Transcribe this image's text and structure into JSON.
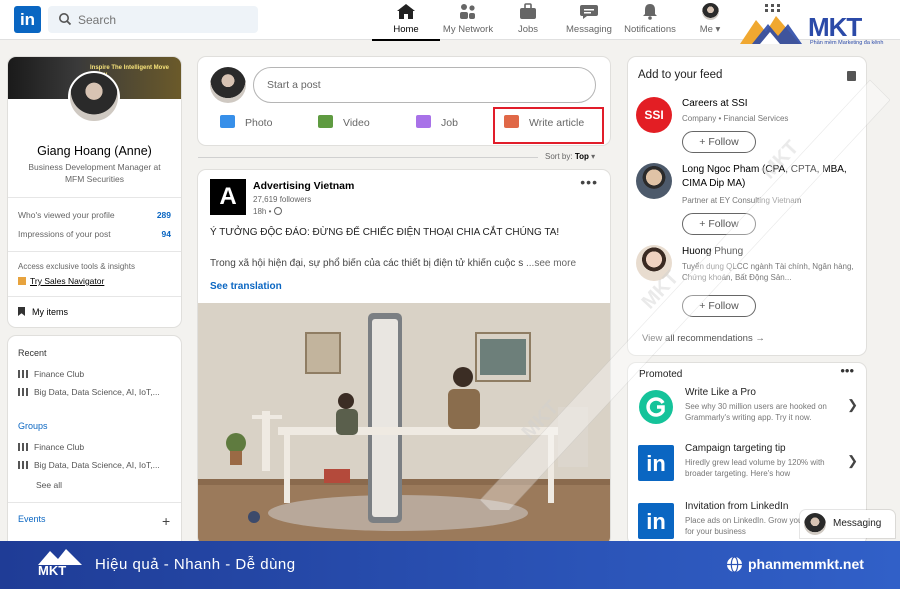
{
  "topnav": {
    "search_placeholder": "Search",
    "items": [
      {
        "label": "Home",
        "icon": "home-icon",
        "active": true
      },
      {
        "label": "My Network",
        "icon": "network-icon"
      },
      {
        "label": "Jobs",
        "icon": "briefcase-icon"
      },
      {
        "label": "Messaging",
        "icon": "message-icon"
      },
      {
        "label": "Notifications",
        "icon": "bell-icon"
      },
      {
        "label": "Me",
        "icon": "avatar"
      }
    ],
    "logo_letters": "in"
  },
  "brand": {
    "name": "MKT",
    "tagline": "Phần mềm Marketing đa kênh",
    "slogan": "Hiệu quả - Nhanh - Dễ dùng",
    "website": "phanmemmkt.net",
    "colors": {
      "primary": "#2b4aa8",
      "accent": "#f0a830"
    }
  },
  "profile": {
    "banner_text": "Inspire The Intelligent Move Today",
    "name": "Giang Hoang (Anne)",
    "title": "Business Development Manager at MFM Securities",
    "stats": [
      {
        "label": "Who's viewed your profile",
        "value": "289"
      },
      {
        "label": "Impressions of your post",
        "value": "94"
      }
    ],
    "access_text": "Access exclusive tools & insights",
    "premium_link": "Try Sales Navigator",
    "my_items": "My items"
  },
  "sidebar": {
    "recent_heading": "Recent",
    "recent": [
      "Finance Club",
      "Big Data, Data Science, AI, IoT,..."
    ],
    "groups_heading": "Groups",
    "groups": [
      "Finance Club",
      "Big Data, Data Science, AI, IoT,..."
    ],
    "see_all": "See all",
    "events_heading": "Events"
  },
  "share_box": {
    "placeholder": "Start a post",
    "actions": [
      {
        "label": "Photo",
        "icon": "photo-icon",
        "color": "#378fe9"
      },
      {
        "label": "Video",
        "icon": "video-icon",
        "color": "#5f9b41"
      },
      {
        "label": "Job",
        "icon": "briefcase-icon",
        "color": "#a872e8"
      },
      {
        "label": "Write article",
        "icon": "article-icon",
        "color": "#e06847"
      }
    ]
  },
  "sort": {
    "label": "Sort by:",
    "value": "Top"
  },
  "post": {
    "logo_letter": "A",
    "company": "Advertising Vietnam",
    "followers": "27,619 followers",
    "time": "18h •",
    "text_line1": "Ý TƯỞNG ĐỘC ĐÁO: ĐỪNG ĐỂ CHIẾC ĐIỆN THOẠI CHIA CẮT CHÚNG TA!",
    "text_line2": "Trong xã hội hiện đại, sự phổ biến của các thiết bị điện tử khiến cuộc s",
    "see_more": "...see more",
    "see_translation": "See translation"
  },
  "add_to_feed": {
    "heading": "Add to your feed",
    "items": [
      {
        "name": "Careers at SSI",
        "subtitle": "Company • Financial Services",
        "follow": "+ Follow"
      },
      {
        "name": "Long Ngoc Pham (CPA, CPTA, MBA, CIMA Dip MA)",
        "subtitle": "Partner at EY Consulting Vietnam",
        "follow": "+ Follow"
      },
      {
        "name": "Huong Phung",
        "subtitle": "Tuyển dụng QLCC ngành Tài chính, Ngân hàng, Chứng khoán, Bất Động Sản...",
        "follow": "+ Follow"
      }
    ],
    "view_all": "View all recommendations →"
  },
  "promoted": {
    "heading": "Promoted",
    "items": [
      {
        "title": "Write Like a Pro",
        "desc": "See why 30 million users are hooked on Grammarly's writing app. Try it now."
      },
      {
        "title": "Campaign targeting tip",
        "desc": "Hiredly grew lead volume by 120% with broader targeting. Here's how"
      },
      {
        "title": "Invitation from LinkedIn",
        "desc": "Place ads on LinkedIn. Grow your customers for your business"
      }
    ]
  },
  "messaging": {
    "label": "Messaging"
  }
}
